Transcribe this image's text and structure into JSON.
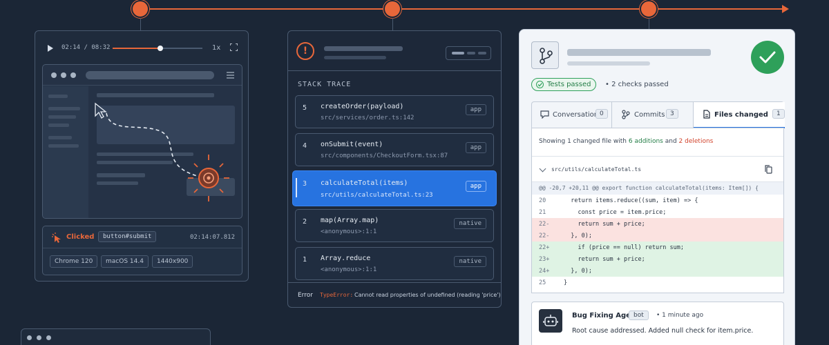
{
  "replay": {
    "time": "02:14 / 08:32",
    "progress": 0.53,
    "speed": "1x",
    "event": {
      "action": "Clicked",
      "selector": "button#submit",
      "timestamp": "02:14:07.812"
    },
    "environment": [
      "Chrome 120",
      "macOS 14.4",
      "1440x900"
    ]
  },
  "trace": {
    "section_label": "STACK TRACE",
    "frames": [
      {
        "index": "5",
        "function": "createOrder(payload)",
        "file": "src/services/order.ts:142",
        "tag": "app",
        "active": false
      },
      {
        "index": "4",
        "function": "onSubmit(event)",
        "file": "src/components/CheckoutForm.tsx:87",
        "tag": "app",
        "active": false
      },
      {
        "index": "3",
        "function": "calculateTotal(items)",
        "file": "src/utils/calculateTotal.ts:23",
        "tag": "app",
        "active": true
      },
      {
        "index": "2",
        "function": "map(Array.map)",
        "file": "<anonymous>:1:1",
        "tag": "native",
        "active": false
      },
      {
        "index": "1",
        "function": "Array.reduce",
        "file": "<anonymous>:1:1",
        "tag": "native",
        "active": false
      }
    ],
    "error": {
      "label": "Error",
      "type": "TypeError:",
      "message": "Cannot read properties of undefined (reading 'price')"
    }
  },
  "pr": {
    "status_pill": "Tests passed",
    "checks": "• 2 checks passed",
    "tabs": [
      {
        "label": "Conversation",
        "count": "0",
        "icon": "conversation-icon"
      },
      {
        "label": "Commits",
        "count": "3",
        "icon": "commits-icon"
      },
      {
        "label": "Files changed",
        "count": "1",
        "icon": "file-icon"
      }
    ],
    "summary": {
      "prefix": "Showing 1 changed file with",
      "additions": "6 additions",
      "middle": "and",
      "deletions": "2 deletions"
    },
    "file_path": "src/utils/calculateTotal.ts",
    "hunk_header": "@@ -20,7 +20,11 @@ export function calculateTotal(items: Item[]) {",
    "diff": [
      {
        "ln": "20",
        "type": "ctx",
        "code": "  return items.reduce((sum, item) => {"
      },
      {
        "ln": "21",
        "type": "ctx",
        "code": "    const price = item.price;"
      },
      {
        "ln": "22-",
        "type": "del",
        "code": "    return sum + price;"
      },
      {
        "ln": "22-",
        "type": "del",
        "code": "  }, 0);"
      },
      {
        "ln": "22+",
        "type": "add",
        "code": "    if (price == null) return sum;"
      },
      {
        "ln": "23+",
        "type": "add",
        "code": "    return sum + price;"
      },
      {
        "ln": "24+",
        "type": "add",
        "code": "  }, 0);"
      },
      {
        "ln": "25",
        "type": "ctx",
        "code": "}"
      }
    ],
    "comment": {
      "author": "Bug Fixing Agent",
      "badge": "bot",
      "time": "• 1 minute ago",
      "message": "Root cause addressed. Added null check for item.price."
    }
  },
  "colors": {
    "accent": "#e8673a",
    "active_frame": "#2773e0",
    "success": "#2ea05a",
    "deletion": "#d1422b",
    "background": "#1b2636"
  }
}
